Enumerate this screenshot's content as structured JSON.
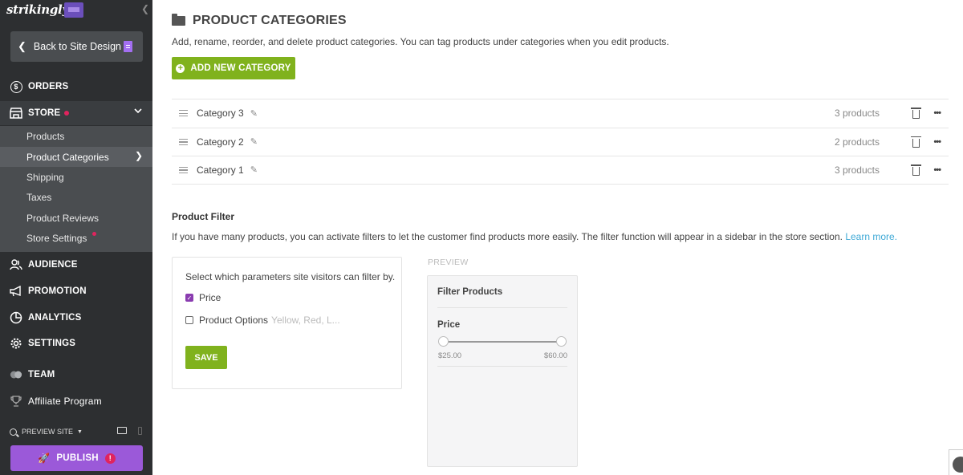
{
  "sidebar": {
    "logo": "strikingly",
    "back_label": "Back to Site Design",
    "nav": {
      "orders": "ORDERS",
      "store": "STORE",
      "audience": "AUDIENCE",
      "promotion": "PROMOTION",
      "analytics": "ANALYTICS",
      "settings": "SETTINGS",
      "team": "TEAM",
      "affiliate": "Affiliate Program"
    },
    "store_items": [
      "Products",
      "Product Categories",
      "Shipping",
      "Taxes",
      "Product Reviews",
      "Store Settings"
    ],
    "active_store_item": "Product Categories",
    "preview_site": "PREVIEW SITE",
    "publish": "PUBLISH"
  },
  "header": {
    "title": "PRODUCT CATEGORIES",
    "description": "Add, rename, reorder, and delete product categories. You can tag products under categories when you edit products.",
    "add_button": "ADD NEW CATEGORY"
  },
  "categories": [
    {
      "name": "Category 3",
      "count": "3 products"
    },
    {
      "name": "Category 2",
      "count": "2 products"
    },
    {
      "name": "Category 1",
      "count": "3 products"
    }
  ],
  "product_filter": {
    "title": "Product Filter",
    "description": "If you have many products, you can activate filters to let the customer find products more easily. The filter function will appear in a sidebar in the store section.",
    "learn_more": "Learn more.",
    "select_label": "Select which parameters site visitors can filter by.",
    "options": [
      {
        "label": "Price",
        "checked": true,
        "hint": ""
      },
      {
        "label": "Product Options",
        "checked": false,
        "hint": "Yellow, Red, L..."
      }
    ],
    "save_label": "SAVE"
  },
  "preview": {
    "label": "PREVIEW",
    "title": "Filter Products",
    "price_label": "Price",
    "min": "$25.00",
    "max": "$60.00"
  },
  "colors": {
    "sidebar_bg": "#2d2f31",
    "accent_green": "#80b21d",
    "publish_purple": "#9b59d9",
    "link_blue": "#3fa9d6",
    "alert_red": "#e0245e"
  }
}
